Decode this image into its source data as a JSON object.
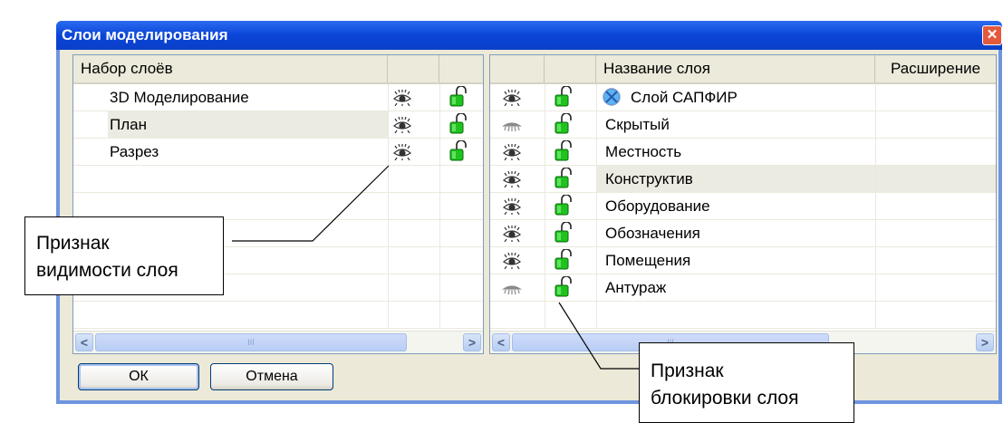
{
  "dialog": {
    "title": "Слои моделирования",
    "close_glyph": "✕"
  },
  "left_panel": {
    "header": "Набор слоёв",
    "rows": [
      {
        "name": "3D Моделирование",
        "visible": true,
        "locked": false
      },
      {
        "name": "План",
        "visible": true,
        "locked": false,
        "selected": true
      },
      {
        "name": "Разрез",
        "visible": true,
        "locked": false
      }
    ],
    "scroll_grip": "III"
  },
  "right_panel": {
    "headers": {
      "name": "Название слоя",
      "extension": "Расширение"
    },
    "rows": [
      {
        "name": "Слой САПФИР",
        "visible": true,
        "locked": false,
        "has_globe": true
      },
      {
        "name": "Скрытый",
        "visible": false,
        "locked": false
      },
      {
        "name": "Местность",
        "visible": true,
        "locked": false
      },
      {
        "name": "Конструктив",
        "visible": true,
        "locked": false,
        "selected": true
      },
      {
        "name": "Оборудование",
        "visible": true,
        "locked": false
      },
      {
        "name": "Обозначения",
        "visible": true,
        "locked": false
      },
      {
        "name": "Помещения",
        "visible": true,
        "locked": false
      },
      {
        "name": "Антураж",
        "visible": false,
        "locked": false
      }
    ],
    "scroll_grip": "III"
  },
  "buttons": {
    "ok": "ОК",
    "cancel": "Отмена"
  },
  "callouts": {
    "visibility_line1": "Признак",
    "visibility_line2": "видимости слоя",
    "lock_line1": "Признак",
    "lock_line2": "блокировки слоя"
  },
  "colors": {
    "title_bar": "#0b45d8",
    "dialog_bg": "#ece9d8",
    "lock_green": "#1fc21f",
    "selected_row": "#ecebe1"
  }
}
